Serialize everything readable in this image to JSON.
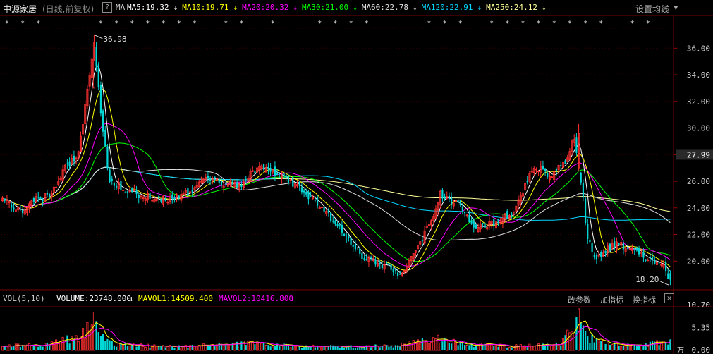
{
  "header": {
    "stock_name": "中源家居",
    "period": "(日线,前复权)",
    "help": "?",
    "ma_prefix": "MA",
    "ma": [
      {
        "label": "MA5:19.32",
        "arrow": "↓",
        "color": "#ffffff"
      },
      {
        "label": "MA10:19.71",
        "arrow": "↓",
        "color": "#ffff00"
      },
      {
        "label": "MA20:20.32",
        "arrow": "↓",
        "color": "#ff00ff"
      },
      {
        "label": "MA30:21.00",
        "arrow": "↓",
        "color": "#00ff00"
      },
      {
        "label": "MA60:22.78",
        "arrow": "↓",
        "color": "#e0e0e0"
      },
      {
        "label": "MA120:22.91",
        "arrow": "↓",
        "color": "#00d8ff"
      },
      {
        "label": "MA250:24.12",
        "arrow": "↓",
        "color": "#ffff99"
      }
    ],
    "settings": "设置均线",
    "settings_arrow": "▼"
  },
  "volume_header": {
    "vol_label": "VOL(5,10)",
    "volume": "VOLUME:23748.000",
    "volume_arrow": "↓",
    "mavol1": "MAVOL1:14509.400",
    "mavol1_arrow": "↑",
    "mavol2": "MAVOL2:10416.800",
    "mavol2_arrow": "↑",
    "buttons": [
      "改参数",
      "加指标",
      "换指标"
    ],
    "close": "✕"
  },
  "chart_data": {
    "type": "candlestick",
    "price_axis": {
      "ticks": [
        "36.00",
        "34.00",
        "32.00",
        "30.00",
        "28.00",
        "26.00",
        "24.00",
        "22.00",
        "20.00"
      ],
      "ylim": [
        18,
        37.5
      ]
    },
    "current_price": "27.99",
    "annotations": {
      "high": "36.98",
      "low": "18.20"
    },
    "volume_axis": {
      "ticks": [
        "10.70",
        "5.35",
        "0.00"
      ],
      "ylim": [
        0,
        10.7
      ],
      "unit": "万"
    },
    "colors": {
      "up": "#ff3030",
      "down": "#00d7d7",
      "ma5": "#ffffff",
      "ma10": "#ffff00",
      "ma20": "#ff00ff",
      "ma30": "#00ff00",
      "ma60": "#e0e0e0",
      "ma120": "#00d8ff",
      "ma250": "#ffff99"
    },
    "waypoints": [
      [
        0,
        24.8
      ],
      [
        8,
        23.6
      ],
      [
        12,
        24.4
      ],
      [
        22,
        25.0
      ],
      [
        28,
        27.0
      ],
      [
        34,
        28.0
      ],
      [
        38,
        33.0
      ],
      [
        41,
        36.5
      ],
      [
        44,
        31.0
      ],
      [
        48,
        26.0
      ],
      [
        60,
        25.0
      ],
      [
        76,
        24.6
      ],
      [
        84,
        25.2
      ],
      [
        92,
        26.2
      ],
      [
        106,
        25.6
      ],
      [
        114,
        27.0
      ],
      [
        122,
        26.6
      ],
      [
        132,
        25.6
      ],
      [
        142,
        24.2
      ],
      [
        152,
        22.2
      ],
      [
        162,
        20.2
      ],
      [
        172,
        19.6
      ],
      [
        178,
        19.0
      ],
      [
        184,
        20.5
      ],
      [
        192,
        23.0
      ],
      [
        196,
        25.0
      ],
      [
        204,
        24.2
      ],
      [
        212,
        22.4
      ],
      [
        220,
        22.9
      ],
      [
        228,
        23.6
      ],
      [
        234,
        25.6
      ],
      [
        238,
        27.2
      ],
      [
        246,
        26.4
      ],
      [
        252,
        27.5
      ],
      [
        256,
        29.3
      ],
      [
        258,
        27.0
      ],
      [
        260,
        24.5
      ],
      [
        262,
        21.6
      ],
      [
        266,
        20.2
      ],
      [
        272,
        21.0
      ],
      [
        276,
        21.3
      ],
      [
        284,
        20.7
      ],
      [
        290,
        20.1
      ],
      [
        296,
        19.6
      ],
      [
        299,
        18.4
      ]
    ],
    "volume_waypoints": [
      [
        0,
        1.0
      ],
      [
        20,
        1.3
      ],
      [
        34,
        3.2
      ],
      [
        39,
        5.2
      ],
      [
        41,
        6.8
      ],
      [
        44,
        3.5
      ],
      [
        50,
        1.3
      ],
      [
        80,
        0.9
      ],
      [
        110,
        1.8
      ],
      [
        130,
        1.0
      ],
      [
        150,
        0.9
      ],
      [
        175,
        1.1
      ],
      [
        185,
        2.0
      ],
      [
        195,
        2.6
      ],
      [
        210,
        1.3
      ],
      [
        230,
        1.0
      ],
      [
        250,
        1.8
      ],
      [
        256,
        5.5
      ],
      [
        258,
        8.0
      ],
      [
        262,
        3.0
      ],
      [
        270,
        1.8
      ],
      [
        285,
        1.0
      ],
      [
        299,
        2.3
      ]
    ],
    "ma_current": {
      "ma5": 19.32,
      "ma10": 19.71,
      "ma20": 20.32,
      "ma30": 21.0,
      "ma60": 22.78,
      "ma120": 22.91,
      "ma250": 24.12
    }
  }
}
